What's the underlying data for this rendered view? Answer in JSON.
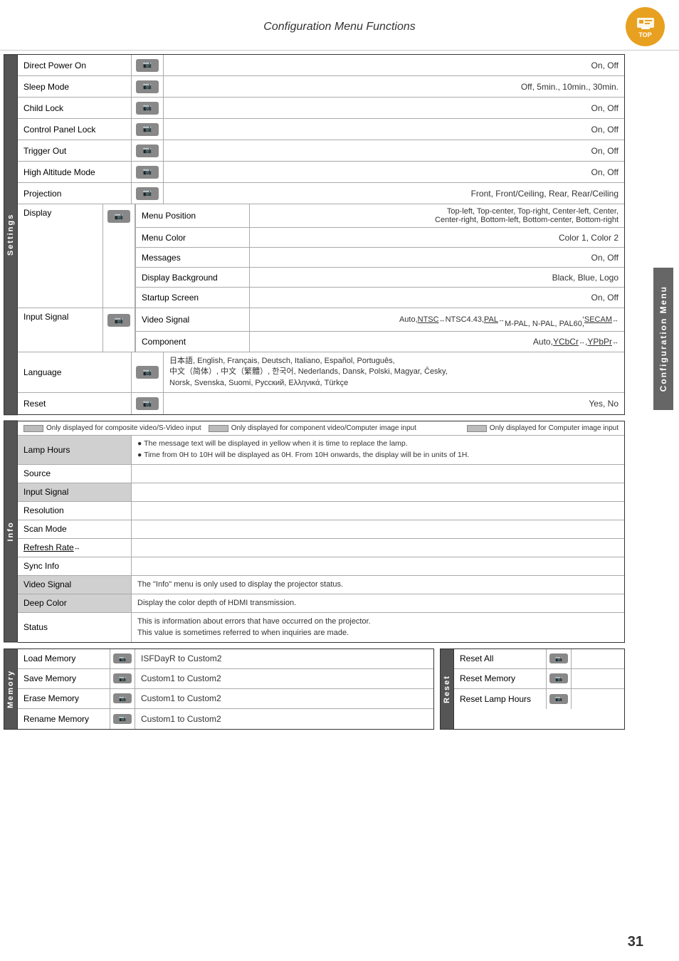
{
  "header": {
    "title": "Configuration Menu Functions",
    "top_label": "TOP",
    "page_number": "31"
  },
  "right_tab": {
    "label": "Configuration Menu"
  },
  "settings_section": {
    "label": "Settings",
    "rows": [
      {
        "id": "direct-power-on",
        "label": "Direct Power On",
        "has_icon": true,
        "value": "On, Off"
      },
      {
        "id": "sleep-mode",
        "label": "Sleep Mode",
        "has_icon": true,
        "value": "Off, 5min., 10min., 30min."
      },
      {
        "id": "child-lock",
        "label": "Child Lock",
        "has_icon": true,
        "value": "On, Off"
      },
      {
        "id": "control-panel-lock",
        "label": "Control Panel Lock",
        "has_icon": true,
        "value": "On, Off"
      },
      {
        "id": "trigger-out",
        "label": "Trigger Out",
        "has_icon": true,
        "value": "On, Off"
      },
      {
        "id": "high-altitude-mode",
        "label": "High Altitude Mode",
        "has_icon": true,
        "value": "On, Off"
      },
      {
        "id": "projection",
        "label": "Projection",
        "has_icon": true,
        "value": "Front, Front/Ceiling, Rear, Rear/Ceiling"
      }
    ],
    "display_row": {
      "label": "Display",
      "has_icon": true,
      "sub_rows": [
        {
          "id": "menu-position",
          "label": "Menu Position",
          "value": "Top-left, Top-center, Top-right, Center-left, Center,\nCenter-right, Bottom-left, Bottom-center, Bottom-right"
        },
        {
          "id": "menu-color",
          "label": "Menu Color",
          "value": "Color 1, Color 2"
        },
        {
          "id": "messages",
          "label": "Messages",
          "value": "On, Off"
        },
        {
          "id": "display-background",
          "label": "Display Background",
          "value": "Black, Blue, Logo"
        },
        {
          "id": "startup-screen",
          "label": "Startup Screen",
          "value": "On, Off"
        }
      ]
    },
    "input_signal_row": {
      "label": "Input Signal",
      "has_icon": true,
      "sub_rows": [
        {
          "id": "video-signal",
          "label": "Video Signal",
          "value": "Auto, NTSC↔ NTSC4.43, PAL↔,\nM-PAL, N-PAL, PAL60, SECAM↔"
        },
        {
          "id": "component",
          "label": "Component",
          "value": "Auto, YCbCr↔, YPbPr↔"
        }
      ]
    },
    "language_row": {
      "label": "Language",
      "has_icon": true,
      "value": "日本語, English, Français, Deutsch, Italiano, Español, Português,\n中文（简体）, 中文（繁體）, 한국어, Nederlands, Dansk, Polski, Magyar, Česky,\nNorsk, Svenska, Suomi, Русский, Ελληνικά, Türkçe"
    },
    "reset_row": {
      "label": "Reset",
      "has_icon": true,
      "value": "Yes, No"
    }
  },
  "info_section": {
    "label": "Info",
    "legend": [
      {
        "id": "composite-legend",
        "text": "Only displayed for composite video/S-Video input"
      },
      {
        "id": "component-legend",
        "text": "Only displayed for component video/Computer image input"
      },
      {
        "id": "computer-legend",
        "text": "Only displayed for Computer image input"
      }
    ],
    "rows": [
      {
        "id": "lamp-hours",
        "label": "Lamp Hours",
        "highlighted": true,
        "value": "● The message text will be displayed in yellow when it is time to replace the lamp.\n● Time from 0H to 10H will be displayed as 0H. From 10H onwards, the display will be in units of 1H."
      },
      {
        "id": "source",
        "label": "Source",
        "highlighted": false,
        "value": ""
      },
      {
        "id": "input-signal",
        "label": "Input Signal",
        "highlighted": true,
        "value": ""
      },
      {
        "id": "resolution",
        "label": "Resolution",
        "highlighted": false,
        "value": ""
      },
      {
        "id": "scan-mode",
        "label": "Scan Mode",
        "highlighted": false,
        "value": ""
      },
      {
        "id": "refresh-rate",
        "label": "Refresh Rate",
        "highlighted": false,
        "value": "",
        "underline": true
      },
      {
        "id": "sync-info",
        "label": "Sync Info",
        "highlighted": false,
        "value": ""
      },
      {
        "id": "video-signal-info",
        "label": "Video Signal",
        "highlighted": true,
        "value": "The \"Info\" menu is only used to display the projector status."
      },
      {
        "id": "deep-color",
        "label": "Deep Color",
        "highlighted": true,
        "value": "Display the color depth of HDMI transmission."
      },
      {
        "id": "status",
        "label": "Status",
        "highlighted": false,
        "value": "This is information about errors that have occurred on the projector.\nThis value is sometimes referred to when inquiries are made."
      }
    ]
  },
  "memory_section": {
    "label": "Memory",
    "rows": [
      {
        "id": "load-memory",
        "label": "Load Memory",
        "has_icon": true,
        "value": "ISFDayR to Custom2"
      },
      {
        "id": "save-memory",
        "label": "Save Memory",
        "has_icon": true,
        "value": "Custom1 to Custom2"
      },
      {
        "id": "erase-memory",
        "label": "Erase Memory",
        "has_icon": true,
        "value": "Custom1 to Custom2"
      },
      {
        "id": "rename-memory",
        "label": "Rename Memory",
        "has_icon": true,
        "value": "Custom1 to Custom2"
      }
    ]
  },
  "reset_section": {
    "label": "Reset",
    "rows": [
      {
        "id": "reset-all",
        "label": "Reset All",
        "has_icon": true
      },
      {
        "id": "reset-memory",
        "label": "Reset Memory",
        "has_icon": true
      },
      {
        "id": "reset-lamp-hours",
        "label": "Reset Lamp Hours",
        "has_icon": true
      }
    ]
  }
}
